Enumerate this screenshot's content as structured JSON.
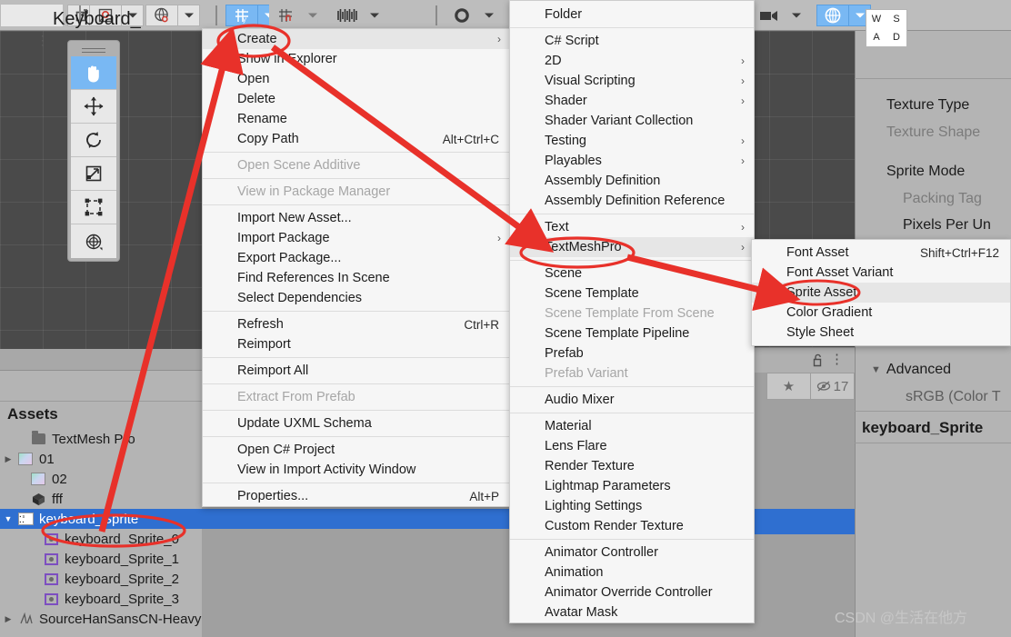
{
  "toolbar": {
    "groups": [
      {
        "name": "pivot-toggle",
        "icon": "pivot-icon",
        "has_caret": true,
        "active": false
      },
      {
        "name": "handle-space-toggle",
        "icon": "globe-icon",
        "has_caret": true,
        "active": false
      },
      {
        "name": "grid-visibility-toggle",
        "icon": "grid-y-icon",
        "has_caret": true,
        "active": true
      },
      {
        "name": "grid-snapping-toggle",
        "icon": "grid-magnet-icon",
        "has_caret": true,
        "active": false
      },
      {
        "name": "layers-toggle",
        "icon": "layers-icon",
        "has_caret": true,
        "active": false
      },
      {
        "name": "scene-visibility-toggle",
        "icon": "circle-icon",
        "has_caret": true,
        "active": false
      },
      {
        "name": "camera-toggle",
        "icon": "camera-icon",
        "has_caret": true,
        "active": false
      },
      {
        "name": "gizmos-toggle",
        "icon": "gizmo-icon",
        "has_caret": true,
        "active": true
      }
    ]
  },
  "tool_palette": {
    "tools": [
      {
        "name": "hand-tool",
        "icon": "hand-icon",
        "active": true
      },
      {
        "name": "move-tool",
        "icon": "move-icon",
        "active": false
      },
      {
        "name": "rotate-tool",
        "icon": "rotate-icon",
        "active": false
      },
      {
        "name": "scale-tool",
        "icon": "scale-icon",
        "active": false
      },
      {
        "name": "rect-tool",
        "icon": "rect-transform-icon",
        "active": false
      },
      {
        "name": "transform-tool",
        "icon": "transform-icon",
        "active": false
      }
    ]
  },
  "project_panel": {
    "header": "Assets",
    "tree": [
      {
        "label": "TextMesh Pro",
        "icon": "folder-icon",
        "indent": 1,
        "twisty": "",
        "selected": false
      },
      {
        "label": "01",
        "icon": "image-icon",
        "indent": 0,
        "twisty": "▶",
        "selected": false
      },
      {
        "label": "02",
        "icon": "image-icon",
        "indent": 1,
        "twisty": "",
        "selected": false
      },
      {
        "label": "fff",
        "icon": "cube-icon",
        "indent": 1,
        "twisty": "",
        "selected": false
      },
      {
        "label": "keyboard_Sprite",
        "icon": "tmp-sprite-icon",
        "indent": 0,
        "twisty": "▼",
        "selected": true
      },
      {
        "label": "keyboard_Sprite_0",
        "icon": "sprite-icon",
        "indent": 2,
        "twisty": "",
        "selected": false
      },
      {
        "label": "keyboard_Sprite_1",
        "icon": "sprite-icon",
        "indent": 2,
        "twisty": "",
        "selected": false
      },
      {
        "label": "keyboard_Sprite_2",
        "icon": "sprite-icon",
        "indent": 2,
        "twisty": "",
        "selected": false
      },
      {
        "label": "keyboard_Sprite_3",
        "icon": "sprite-icon",
        "indent": 2,
        "twisty": "",
        "selected": false
      },
      {
        "label": "SourceHanSansCN-Heavy",
        "icon": "font-icon",
        "indent": 0,
        "twisty": "▶",
        "selected": false
      }
    ]
  },
  "inspector": {
    "thumbnail_keys": [
      "W",
      "S",
      "A",
      "D"
    ],
    "title": "Keyboard_",
    "rows": [
      {
        "label": "Texture Type",
        "dim": false
      },
      {
        "label": "Texture Shape",
        "dim": true
      },
      {
        "label": "Sprite Mode",
        "dim": false
      },
      {
        "label": "Packing Tag",
        "dim": true
      },
      {
        "label": "Pixels Per Un",
        "dim": false
      }
    ],
    "advanced_label": "Advanced",
    "srgb_label": "sRGB (Color T",
    "asset_name": "keyboard_Sprite",
    "preview_count": "17",
    "lock_icon": "lock-open-icon",
    "menu_icon": "kebab-menu-icon",
    "favorite_icon": "star-icon",
    "visibility_icon": "eye-off-icon"
  },
  "menu_context": {
    "items": [
      {
        "label": "Create",
        "shortcut": "",
        "arrow": true,
        "dim": false,
        "highlight": true
      },
      {
        "label": "Show in Explorer",
        "shortcut": "",
        "arrow": false,
        "dim": false,
        "highlight": false
      },
      {
        "label": "Open",
        "shortcut": "",
        "arrow": false,
        "dim": false,
        "highlight": false
      },
      {
        "label": "Delete",
        "shortcut": "",
        "arrow": false,
        "dim": false,
        "highlight": false
      },
      {
        "label": "Rename",
        "shortcut": "",
        "arrow": false,
        "dim": false,
        "highlight": false
      },
      {
        "label": "Copy Path",
        "shortcut": "Alt+Ctrl+C",
        "arrow": false,
        "dim": false,
        "highlight": false
      },
      {
        "separator": true
      },
      {
        "label": "Open Scene Additive",
        "shortcut": "",
        "arrow": false,
        "dim": true,
        "highlight": false
      },
      {
        "separator": true
      },
      {
        "label": "View in Package Manager",
        "shortcut": "",
        "arrow": false,
        "dim": true,
        "highlight": false
      },
      {
        "separator": true
      },
      {
        "label": "Import New Asset...",
        "shortcut": "",
        "arrow": false,
        "dim": false,
        "highlight": false
      },
      {
        "label": "Import Package",
        "shortcut": "",
        "arrow": true,
        "dim": false,
        "highlight": false
      },
      {
        "label": "Export Package...",
        "shortcut": "",
        "arrow": false,
        "dim": false,
        "highlight": false
      },
      {
        "label": "Find References In Scene",
        "shortcut": "",
        "arrow": false,
        "dim": false,
        "highlight": false
      },
      {
        "label": "Select Dependencies",
        "shortcut": "",
        "arrow": false,
        "dim": false,
        "highlight": false
      },
      {
        "separator": true
      },
      {
        "label": "Refresh",
        "shortcut": "Ctrl+R",
        "arrow": false,
        "dim": false,
        "highlight": false
      },
      {
        "label": "Reimport",
        "shortcut": "",
        "arrow": false,
        "dim": false,
        "highlight": false
      },
      {
        "separator": true
      },
      {
        "label": "Reimport All",
        "shortcut": "",
        "arrow": false,
        "dim": false,
        "highlight": false
      },
      {
        "separator": true
      },
      {
        "label": "Extract From Prefab",
        "shortcut": "",
        "arrow": false,
        "dim": true,
        "highlight": false
      },
      {
        "separator": true
      },
      {
        "label": "Update UXML Schema",
        "shortcut": "",
        "arrow": false,
        "dim": false,
        "highlight": false
      },
      {
        "separator": true
      },
      {
        "label": "Open C# Project",
        "shortcut": "",
        "arrow": false,
        "dim": false,
        "highlight": false
      },
      {
        "label": "View in Import Activity Window",
        "shortcut": "",
        "arrow": false,
        "dim": false,
        "highlight": false
      },
      {
        "separator": true
      },
      {
        "label": "Properties...",
        "shortcut": "Alt+P",
        "arrow": false,
        "dim": false,
        "highlight": false
      }
    ]
  },
  "menu_create": {
    "items": [
      {
        "label": "Folder",
        "shortcut": "",
        "arrow": false,
        "dim": false,
        "highlight": false
      },
      {
        "separator": true
      },
      {
        "label": "C# Script",
        "shortcut": "",
        "arrow": false,
        "dim": false,
        "highlight": false
      },
      {
        "label": "2D",
        "shortcut": "",
        "arrow": true,
        "dim": false,
        "highlight": false
      },
      {
        "label": "Visual Scripting",
        "shortcut": "",
        "arrow": true,
        "dim": false,
        "highlight": false
      },
      {
        "label": "Shader",
        "shortcut": "",
        "arrow": true,
        "dim": false,
        "highlight": false
      },
      {
        "label": "Shader Variant Collection",
        "shortcut": "",
        "arrow": false,
        "dim": false,
        "highlight": false
      },
      {
        "label": "Testing",
        "shortcut": "",
        "arrow": true,
        "dim": false,
        "highlight": false
      },
      {
        "label": "Playables",
        "shortcut": "",
        "arrow": true,
        "dim": false,
        "highlight": false
      },
      {
        "label": "Assembly Definition",
        "shortcut": "",
        "arrow": false,
        "dim": false,
        "highlight": false
      },
      {
        "label": "Assembly Definition Reference",
        "shortcut": "",
        "arrow": false,
        "dim": false,
        "highlight": false
      },
      {
        "separator": true
      },
      {
        "label": "Text",
        "shortcut": "",
        "arrow": true,
        "dim": false,
        "highlight": false
      },
      {
        "label": "TextMeshPro",
        "shortcut": "",
        "arrow": true,
        "dim": false,
        "highlight": true
      },
      {
        "separator": true
      },
      {
        "label": "Scene",
        "shortcut": "",
        "arrow": false,
        "dim": false,
        "highlight": false
      },
      {
        "label": "Scene Template",
        "shortcut": "",
        "arrow": false,
        "dim": false,
        "highlight": false
      },
      {
        "label": "Scene Template From Scene",
        "shortcut": "",
        "arrow": false,
        "dim": true,
        "highlight": false
      },
      {
        "label": "Scene Template Pipeline",
        "shortcut": "",
        "arrow": false,
        "dim": false,
        "highlight": false
      },
      {
        "label": "Prefab",
        "shortcut": "",
        "arrow": false,
        "dim": false,
        "highlight": false
      },
      {
        "label": "Prefab Variant",
        "shortcut": "",
        "arrow": false,
        "dim": true,
        "highlight": false
      },
      {
        "separator": true
      },
      {
        "label": "Audio Mixer",
        "shortcut": "",
        "arrow": false,
        "dim": false,
        "highlight": false
      },
      {
        "separator": true
      },
      {
        "label": "Material",
        "shortcut": "",
        "arrow": false,
        "dim": false,
        "highlight": false
      },
      {
        "label": "Lens Flare",
        "shortcut": "",
        "arrow": false,
        "dim": false,
        "highlight": false
      },
      {
        "label": "Render Texture",
        "shortcut": "",
        "arrow": false,
        "dim": false,
        "highlight": false
      },
      {
        "label": "Lightmap Parameters",
        "shortcut": "",
        "arrow": false,
        "dim": false,
        "highlight": false
      },
      {
        "label": "Lighting Settings",
        "shortcut": "",
        "arrow": false,
        "dim": false,
        "highlight": false
      },
      {
        "label": "Custom Render Texture",
        "shortcut": "",
        "arrow": false,
        "dim": false,
        "highlight": false
      },
      {
        "separator": true
      },
      {
        "label": "Animator Controller",
        "shortcut": "",
        "arrow": false,
        "dim": false,
        "highlight": false
      },
      {
        "label": "Animation",
        "shortcut": "",
        "arrow": false,
        "dim": false,
        "highlight": false
      },
      {
        "label": "Animator Override Controller",
        "shortcut": "",
        "arrow": false,
        "dim": false,
        "highlight": false
      },
      {
        "label": "Avatar Mask",
        "shortcut": "",
        "arrow": false,
        "dim": false,
        "highlight": false
      }
    ]
  },
  "menu_textmeshpro": {
    "items": [
      {
        "label": "Font Asset",
        "shortcut": "Shift+Ctrl+F12",
        "arrow": false,
        "dim": false,
        "highlight": false
      },
      {
        "label": "Font Asset Variant",
        "shortcut": "",
        "arrow": false,
        "dim": false,
        "highlight": false
      },
      {
        "label": "Sprite Asset",
        "shortcut": "",
        "arrow": false,
        "dim": false,
        "highlight": true
      },
      {
        "label": "Color Gradient",
        "shortcut": "",
        "arrow": false,
        "dim": false,
        "highlight": false
      },
      {
        "label": "Style Sheet",
        "shortcut": "",
        "arrow": false,
        "dim": false,
        "highlight": false
      }
    ]
  },
  "annotations": {
    "accent_color": "#e8312a",
    "ellipses": [
      "Create",
      "TextMeshPro",
      "Sprite Asset",
      "keyboard_Sprite"
    ],
    "arrows": 3
  },
  "watermark": "CSDN @生活在他方"
}
